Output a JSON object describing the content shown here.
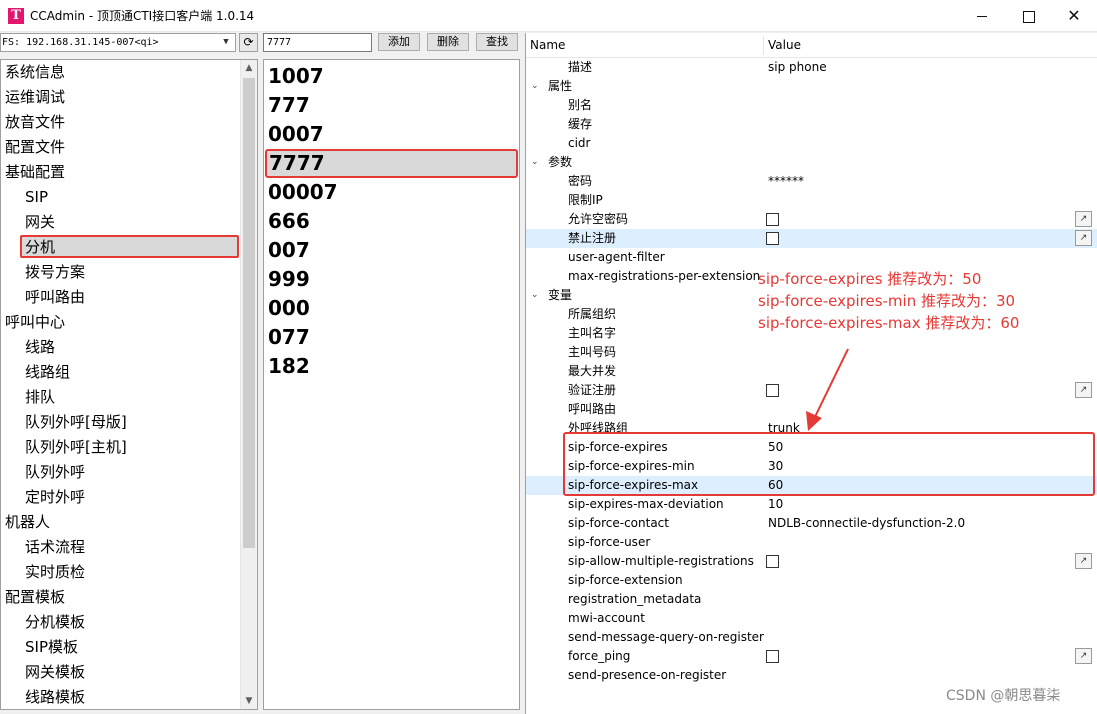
{
  "window": {
    "logo_letter": "T",
    "title": "CCAdmin - 顶顶通CTI接口客户端 1.0.14",
    "minimize": "",
    "maximize": "",
    "close": "✕"
  },
  "toolbar": {
    "fs_selected": "FS: 192.168.31.145-007<qi>",
    "refresh_icon": "⟳",
    "search_value": "7777",
    "add_label": "添加",
    "delete_label": "删除",
    "find_label": "查找"
  },
  "tree": {
    "items": [
      {
        "label": "系统信息",
        "level": 0
      },
      {
        "label": "运维调试",
        "level": 0
      },
      {
        "label": "放音文件",
        "level": 0
      },
      {
        "label": "配置文件",
        "level": 0
      },
      {
        "label": "基础配置",
        "level": 0
      },
      {
        "label": "SIP",
        "level": 1
      },
      {
        "label": "网关",
        "level": 1
      },
      {
        "label": "分机",
        "level": 1,
        "selected": true
      },
      {
        "label": "拨号方案",
        "level": 1
      },
      {
        "label": "呼叫路由",
        "level": 1
      },
      {
        "label": "呼叫中心",
        "level": 0
      },
      {
        "label": "线路",
        "level": 1
      },
      {
        "label": "线路组",
        "level": 1
      },
      {
        "label": "排队",
        "level": 1
      },
      {
        "label": "队列外呼[母版]",
        "level": 1
      },
      {
        "label": "队列外呼[主机]",
        "level": 1
      },
      {
        "label": "队列外呼",
        "level": 1
      },
      {
        "label": "定时外呼",
        "level": 1
      },
      {
        "label": "机器人",
        "level": 0
      },
      {
        "label": "话术流程",
        "level": 1
      },
      {
        "label": "实时质检",
        "level": 1
      },
      {
        "label": "配置模板",
        "level": 0
      },
      {
        "label": "分机模板",
        "level": 1
      },
      {
        "label": "SIP模板",
        "level": 1
      },
      {
        "label": "网关模板",
        "level": 1
      },
      {
        "label": "线路模板",
        "level": 1
      }
    ]
  },
  "extensions": {
    "items": [
      "1007",
      "777",
      "0007",
      "7777",
      "00007",
      "666",
      "007",
      "999",
      "000",
      "077",
      "182"
    ],
    "selected_index": 3
  },
  "grid": {
    "header_name": "Name",
    "header_value": "Value",
    "rows": [
      {
        "name": "描述",
        "value": "sip phone"
      },
      {
        "name": "属性",
        "category": true
      },
      {
        "name": "别名"
      },
      {
        "name": "缓存"
      },
      {
        "name": "cidr"
      },
      {
        "name": "参数",
        "category": true
      },
      {
        "name": "密码",
        "value": "******"
      },
      {
        "name": "限制IP"
      },
      {
        "name": "允许空密码",
        "checkbox": true,
        "button": true
      },
      {
        "name": "禁止注册",
        "checkbox": true,
        "button": true,
        "highlight": true
      },
      {
        "name": "user-agent-filter"
      },
      {
        "name": "max-registrations-per-extension"
      },
      {
        "name": "变量",
        "category": true
      },
      {
        "name": "所属组织"
      },
      {
        "name": "主叫名字"
      },
      {
        "name": "主叫号码"
      },
      {
        "name": "最大并发"
      },
      {
        "name": "验证注册",
        "checkbox": true,
        "button": true
      },
      {
        "name": "呼叫路由"
      },
      {
        "name": "外呼线路组",
        "value": "trunk"
      },
      {
        "name": "sip-force-expires",
        "value": "50"
      },
      {
        "name": "sip-force-expires-min",
        "value": "30"
      },
      {
        "name": "sip-force-expires-max",
        "value": "60",
        "highlight": true
      },
      {
        "name": "sip-expires-max-deviation",
        "value": "10"
      },
      {
        "name": "sip-force-contact",
        "value": "NDLB-connectile-dysfunction-2.0"
      },
      {
        "name": "sip-force-user"
      },
      {
        "name": "sip-allow-multiple-registrations",
        "checkbox": true,
        "button": true
      },
      {
        "name": "sip-force-extension"
      },
      {
        "name": "registration_metadata"
      },
      {
        "name": "mwi-account"
      },
      {
        "name": "send-message-query-on-register"
      },
      {
        "name": "force_ping",
        "checkbox": true,
        "button": true
      },
      {
        "name": "send-presence-on-register"
      }
    ],
    "chevron_glyph": "⌄",
    "edit_button_glyph": "↗"
  },
  "annotation": {
    "lines": [
      "sip-force-expires 推荐改为：50",
      "sip-force-expires-min 推荐改为：30",
      "sip-force-expires-max 推荐改为：60"
    ],
    "color": "#e53935"
  },
  "watermark": "CSDN @朝思暮柒",
  "scroll_icons": {
    "up": "▲",
    "down": "▼",
    "dropdown": "▼"
  }
}
